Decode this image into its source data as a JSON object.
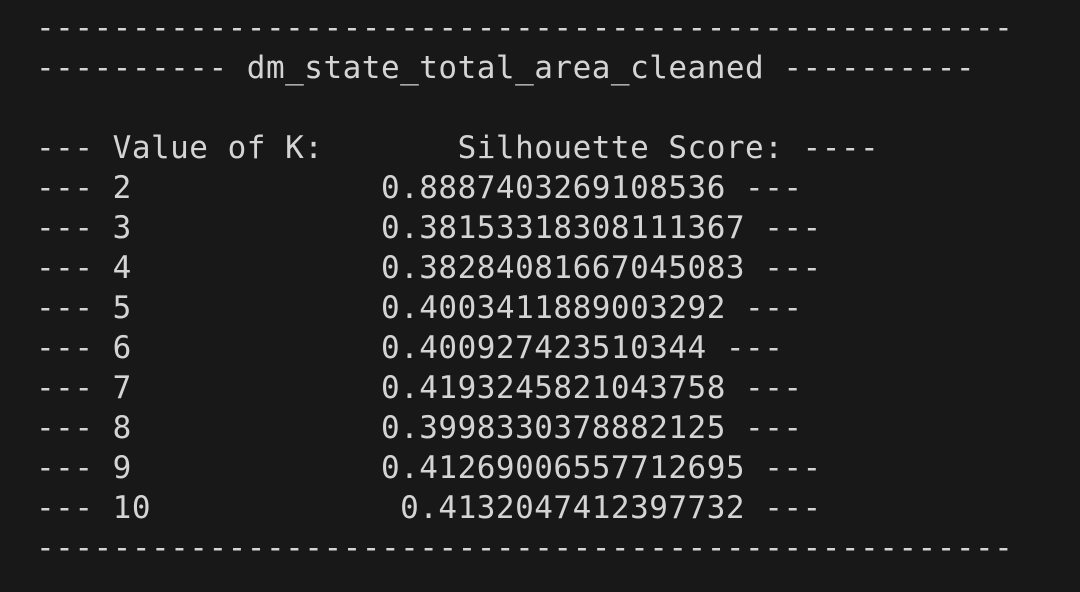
{
  "terminal": {
    "lines": [
      "---------------------------------------------------",
      "---------- dm_state_total_area_cleaned ----------",
      "",
      "--- Value of K:       Silhouette Score: ----",
      "--- 2             0.8887403269108536 ---",
      "--- 3             0.38153318308111367 ---",
      "--- 4             0.38284081667045083 ---",
      "--- 5             0.4003411889003292 ---",
      "--- 6             0.400927423510344 ---",
      "--- 7             0.4193245821043758 ---",
      "--- 8             0.3998330378882125 ---",
      "--- 9             0.41269006557712695 ---",
      "--- 10             0.4132047412397732 ---",
      "---------------------------------------------------"
    ]
  }
}
